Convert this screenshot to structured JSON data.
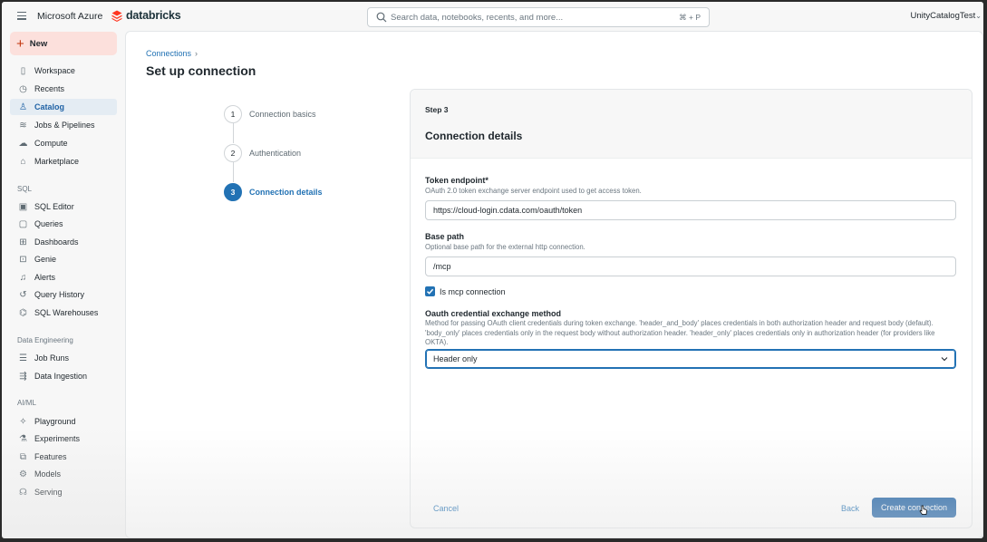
{
  "topbar": {
    "azure_label": "Microsoft Azure",
    "brand_name": "databricks",
    "search_placeholder": "Search data, notebooks, recents, and more...",
    "search_shortcut": "⌘ + P",
    "workspace_name": "UnityCatalogTest"
  },
  "sidebar": {
    "new_label": "New",
    "top_items": [
      {
        "label": "Workspace",
        "icon": "workspace-icon"
      },
      {
        "label": "Recents",
        "icon": "clock-icon"
      },
      {
        "label": "Catalog",
        "icon": "catalog-icon",
        "active": true
      },
      {
        "label": "Jobs & Pipelines",
        "icon": "jobs-icon"
      },
      {
        "label": "Compute",
        "icon": "cloud-icon"
      },
      {
        "label": "Marketplace",
        "icon": "store-icon"
      }
    ],
    "sql_heading": "SQL",
    "sql_items": [
      {
        "label": "SQL Editor",
        "icon": "editor-icon"
      },
      {
        "label": "Queries",
        "icon": "query-icon"
      },
      {
        "label": "Dashboards",
        "icon": "dashboard-icon"
      },
      {
        "label": "Genie",
        "icon": "genie-icon"
      },
      {
        "label": "Alerts",
        "icon": "bell-icon"
      },
      {
        "label": "Query History",
        "icon": "history-icon"
      },
      {
        "label": "SQL Warehouses",
        "icon": "warehouse-icon"
      }
    ],
    "de_heading": "Data Engineering",
    "de_items": [
      {
        "label": "Job Runs",
        "icon": "list-icon"
      },
      {
        "label": "Data Ingestion",
        "icon": "ingestion-icon"
      }
    ],
    "ml_heading": "AI/ML",
    "ml_items": [
      {
        "label": "Playground",
        "icon": "sparkle-icon"
      },
      {
        "label": "Experiments",
        "icon": "flask-icon"
      },
      {
        "label": "Features",
        "icon": "features-icon"
      },
      {
        "label": "Models",
        "icon": "models-icon"
      },
      {
        "label": "Serving",
        "icon": "serving-icon"
      }
    ]
  },
  "main": {
    "breadcrumb": "Connections",
    "breadcrumb_sep": "›",
    "title": "Set up connection",
    "steps": [
      {
        "num": "1",
        "label": "Connection basics"
      },
      {
        "num": "2",
        "label": "Authentication"
      },
      {
        "num": "3",
        "label": "Connection details",
        "current": true
      }
    ],
    "panel": {
      "step_label": "Step 3",
      "title": "Connection details",
      "token_endpoint": {
        "label": "Token endpoint*",
        "help": "OAuth 2.0 token exchange server endpoint used to get access token.",
        "value": "https://cloud-login.cdata.com/oauth/token"
      },
      "base_path": {
        "label": "Base path",
        "help": "Optional base path for the external http connection.",
        "value": "/mcp"
      },
      "is_mcp": {
        "label": "Is mcp connection",
        "checked": true
      },
      "oauth_method": {
        "label": "Oauth credential exchange method",
        "help": "Method for passing OAuth client credentials during token exchange. 'header_and_body' places credentials in both authorization header and request body (default). 'body_only' places credentials only in the request body without authorization header. 'header_only' places credentials only in authorization header (for providers like OKTA).",
        "value": "Header only"
      },
      "cancel_label": "Cancel",
      "back_label": "Back",
      "create_label": "Create connection"
    }
  },
  "colors": {
    "accent": "#2272b4",
    "primary_button": "#1f62a5",
    "new_button_bg": "#fce0dc",
    "brand_red": "#ff3621"
  }
}
